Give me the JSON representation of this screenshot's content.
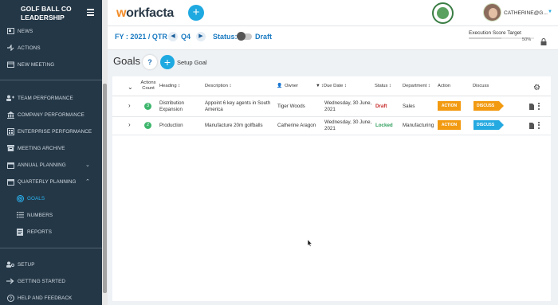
{
  "sidebar": {
    "brand_line1": "GOLF BALL CO",
    "brand_line2": "LEADERSHIP",
    "items": [
      {
        "label": "NEWS",
        "icon": "news-icon"
      },
      {
        "label": "ACTIONS",
        "icon": "actions-icon"
      },
      {
        "label": "NEW MEETING",
        "icon": "new-meeting-icon"
      },
      {
        "label": "TEAM PERFORMANCE",
        "icon": "team-icon"
      },
      {
        "label": "COMPANY PERFORMANCE",
        "icon": "company-icon"
      },
      {
        "label": "ENTERPRISE PERFORMANCE",
        "icon": "enterprise-icon"
      },
      {
        "label": "MEETING ARCHIVE",
        "icon": "archive-icon"
      },
      {
        "label": "ANNUAL PLANNING",
        "icon": "calendar-icon"
      },
      {
        "label": "QUARTERLY PLANNING",
        "icon": "calendar-icon"
      },
      {
        "label": "GOALS",
        "icon": "target-icon"
      },
      {
        "label": "NUMBERS",
        "icon": "list-icon"
      },
      {
        "label": "REPORTS",
        "icon": "report-icon"
      },
      {
        "label": "SETUP",
        "icon": "setup-icon"
      },
      {
        "label": "GETTING STARTED",
        "icon": "getting-started-icon"
      },
      {
        "label": "HELP AND FEEDBACK",
        "icon": "help-icon"
      }
    ]
  },
  "header": {
    "logo_w": "w",
    "logo_rest": "orkfacta",
    "user_name": "CATHERINE@G..."
  },
  "subbar": {
    "fy": "FY : 2021 / QTR",
    "quarter": "Q4",
    "status_label": "Status:",
    "status_value": "Draft",
    "exec_label": "Execution Score Target",
    "exec_pct": "50%",
    "exec_value": 0.5
  },
  "goals": {
    "title": "Goals",
    "help": "?",
    "setup_label": "Setup Goal"
  },
  "table": {
    "headers": {
      "actions_count": "Actions Count",
      "heading": "Heading ↕",
      "description": "Description ↕",
      "owner": "Owner",
      "due_date": "↕Due Date ↕",
      "status": "Status ↕",
      "department": "Department ↕",
      "action": "Action",
      "discuss": "Discuss"
    },
    "rows": [
      {
        "count": "3",
        "heading_l1": "Distribution",
        "heading_l2": "Expansion",
        "desc_l1": "Appoint 6 key agents in South",
        "desc_l2": "America",
        "owner": "Tiger Woods",
        "due_l1": "Wednesday, 30 June,",
        "due_l2": "2021",
        "status": "Draft",
        "department": "Sales",
        "action": "ACTION",
        "discuss": "DISCUSS"
      },
      {
        "count": "2",
        "heading_l1": "Production",
        "heading_l2": "",
        "desc_l1": "Manufacture 20m golfballs",
        "desc_l2": "",
        "owner": "Catherine Aragon",
        "due_l1": "Wednesday, 30 June,",
        "due_l2": "2021",
        "status": "Locked",
        "department": "Manufacturing",
        "action": "ACTION",
        "discuss": "DISCUSS"
      }
    ]
  },
  "colors": {
    "sidebar_bg": "#243746",
    "accent_blue": "#1fa9e1",
    "action_orange": "#f29a11",
    "draft_red": "#c62828",
    "locked_green": "#2e9e5b"
  }
}
